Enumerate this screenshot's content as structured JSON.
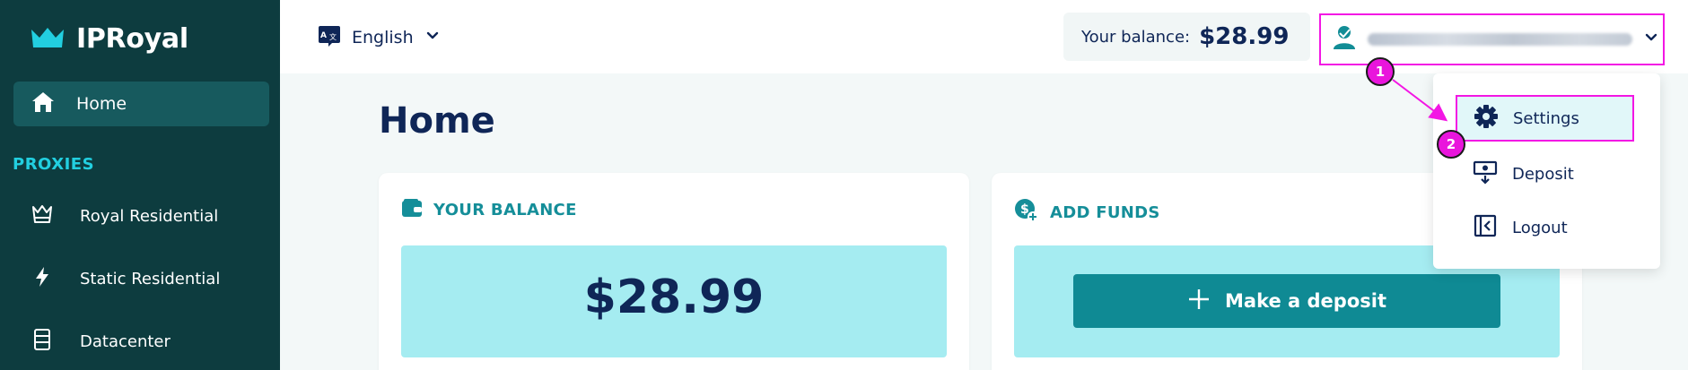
{
  "sidebar": {
    "logo_text": "IPRoyal",
    "home_label": "Home",
    "section_title": "PROXIES",
    "items": [
      {
        "label": "Royal Residential"
      },
      {
        "label": "Static Residential"
      },
      {
        "label": "Datacenter"
      }
    ]
  },
  "topbar": {
    "language": "English",
    "balance_label": "Your balance:",
    "balance_value": "$28.99"
  },
  "main": {
    "page_title": "Home",
    "balance_card": {
      "title": "YOUR BALANCE",
      "amount": "$28.99"
    },
    "funds_card": {
      "title": "ADD FUNDS",
      "button_label": "Make a deposit"
    }
  },
  "user_menu": {
    "items": [
      {
        "label": "Settings",
        "icon": "gear-icon"
      },
      {
        "label": "Deposit",
        "icon": "deposit-icon"
      },
      {
        "label": "Logout",
        "icon": "logout-icon"
      }
    ]
  },
  "annotations": {
    "marker_1": "1",
    "marker_2": "2",
    "highlight_color": "#f316e4"
  },
  "colors": {
    "sidebar_bg": "#0d3c3f",
    "sidebar_active": "#175a5e",
    "accent_cyan": "#22cfe0",
    "teal": "#0f8a94",
    "panel_cyan": "#a5ecf1",
    "navy": "#0f2657"
  }
}
